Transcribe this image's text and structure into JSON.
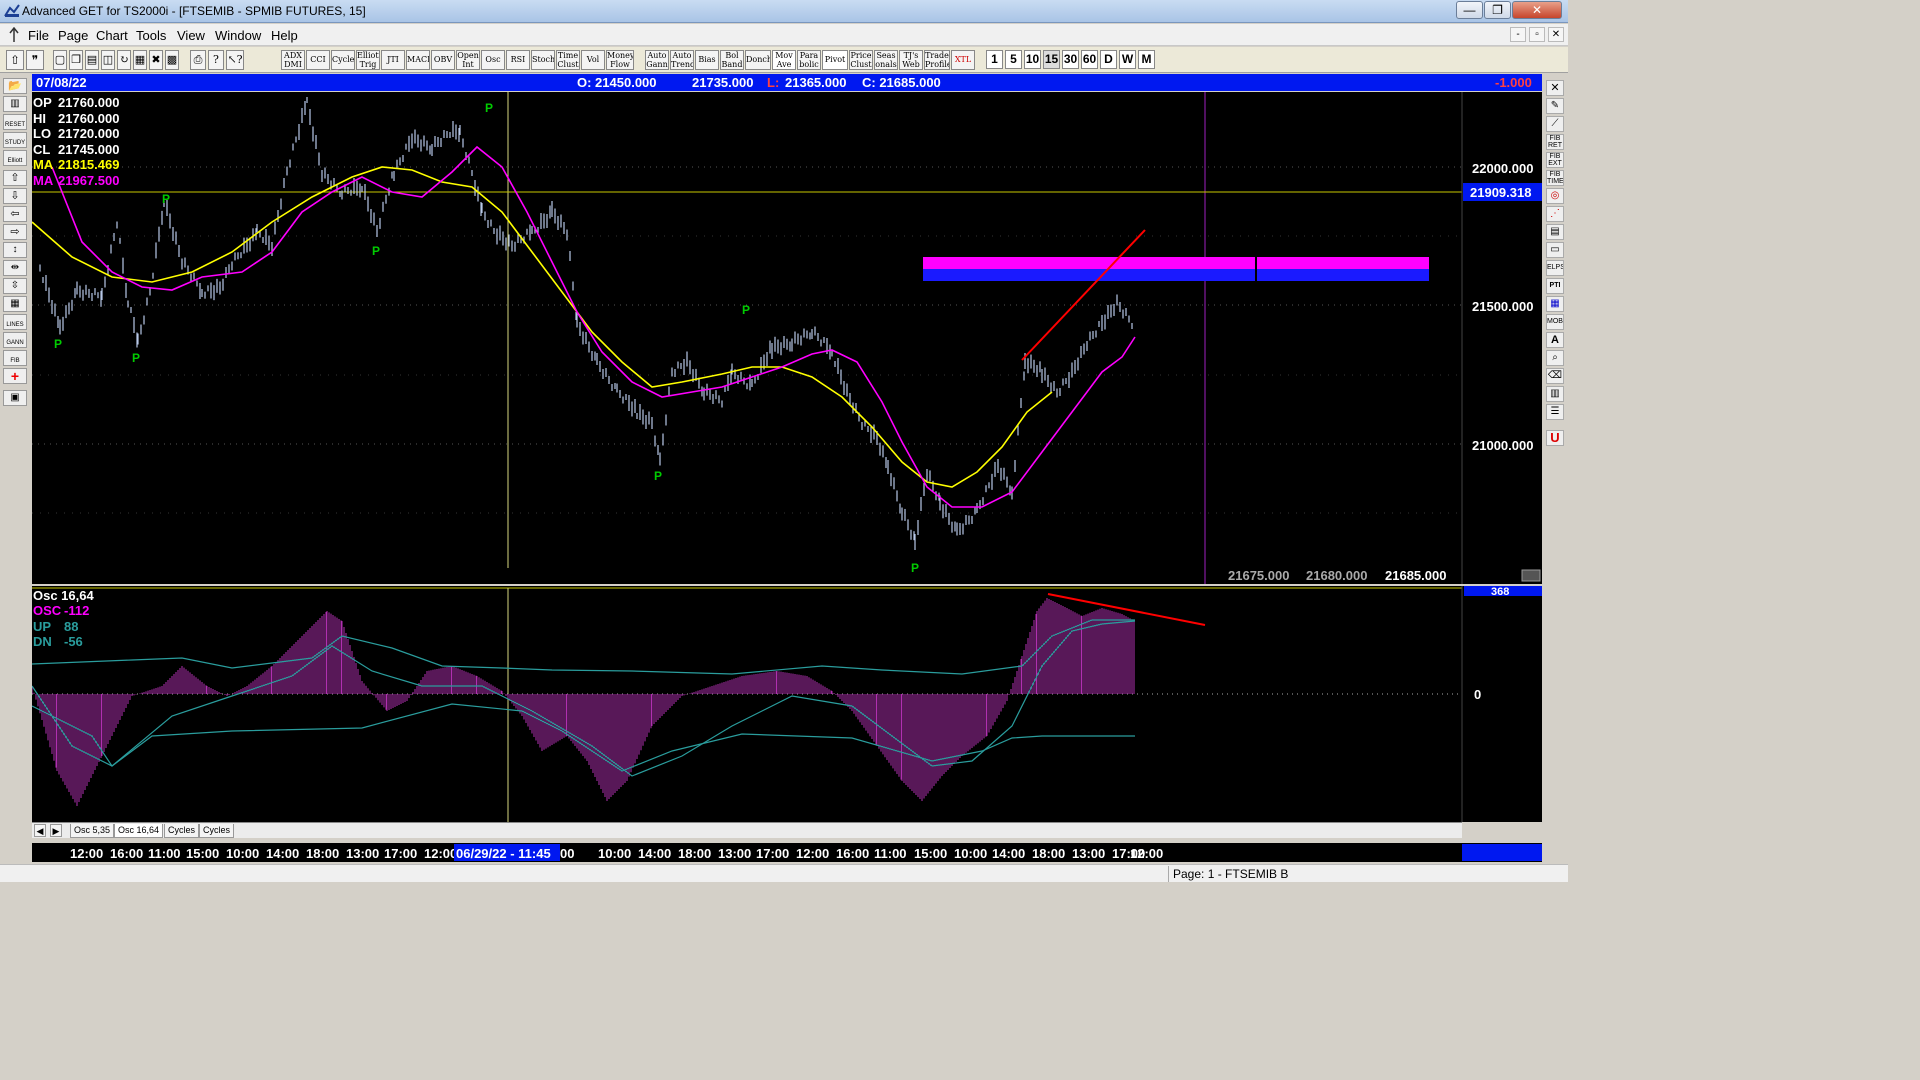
{
  "window": {
    "title": "Advanced GET for TS2000i - [FTSEMIB - SPMIB FUTURES, 15]",
    "buttons": {
      "minimize": "—",
      "restore": "❐",
      "close": "✕"
    }
  },
  "menu": {
    "items": [
      "File",
      "Page",
      "Chart",
      "Tools",
      "View",
      "Window",
      "Help"
    ],
    "mdi_buttons": [
      "-",
      "▫",
      "✕"
    ]
  },
  "toolbar": {
    "indicators": [
      "ADX DMI",
      "CCI",
      "Cycles",
      "Elliott Trig",
      "JTI",
      "MACD",
      "OBV",
      "Open Int",
      "Osc",
      "RSI",
      "Stoch",
      "Time Clust",
      "Vol",
      "Money Flow",
      "Auto Gann",
      "Auto Trend",
      "Bias",
      "Bol Band",
      "Donch",
      "Mov Ave",
      "Para bolic",
      "Pivot",
      "Price Clust",
      "Seas onals",
      "TJ's Web",
      "Trade Profile",
      "XTL"
    ],
    "timeframes": [
      "1",
      "5",
      "10",
      "15",
      "30",
      "60",
      "D",
      "W",
      "M"
    ]
  },
  "left_tools": [
    "",
    "",
    "RESET",
    "STUDY",
    "Elliott",
    "",
    "",
    "",
    "",
    "",
    "",
    "",
    "LINES",
    "GANN",
    "FIB",
    "+",
    ""
  ],
  "right_tools": [
    "✕",
    "",
    "",
    "FIB RET",
    "FIB EXT",
    "FIB TIME",
    "",
    "",
    "",
    "",
    "ELPS",
    "PTI",
    "",
    "MOB",
    "A",
    "",
    "",
    "",
    "",
    "U"
  ],
  "info_bar": {
    "date": "07/08/22",
    "open": "O: 21450.000",
    "high": "21735.000",
    "low_label": "L:",
    "low": "21365.000",
    "close": "C: 21685.000",
    "change": "-1.000"
  },
  "price_panel": {
    "readout": [
      {
        "label": "OP",
        "value": "21760.000",
        "color": "#ffffff"
      },
      {
        "label": "HI",
        "value": "21760.000",
        "color": "#ffffff"
      },
      {
        "label": "LO",
        "value": "21720.000",
        "color": "#ffffff"
      },
      {
        "label": "CL",
        "value": "21745.000",
        "color": "#ffffff"
      },
      {
        "label": "MA",
        "value": "21815.469",
        "color": "#ffff00"
      },
      {
        "label": "MA",
        "value": "21967.500",
        "color": "#ff00ff"
      }
    ],
    "axis_labels": [
      "22000.000",
      "21500.000",
      "21000.000"
    ],
    "current_price_label": "21909.318",
    "bottom_readouts": [
      "21675.000",
      "21680.000",
      "21685.000"
    ],
    "pivot_marker": "P"
  },
  "osc_panel": {
    "title": "Osc 16,64",
    "readout": [
      {
        "label": "OSC",
        "value": "-112",
        "color": "#ff00ff"
      },
      {
        "label": "UP",
        "value": "88",
        "color": "#2a9d9d"
      },
      {
        "label": "DN",
        "value": "-56",
        "color": "#2a9d9d"
      }
    ],
    "axis_top": "368",
    "axis_zero": "0"
  },
  "tabs": [
    "Osc 5,35",
    "Osc 16,64",
    "Cycles",
    "Cycles"
  ],
  "time_axis": {
    "labels": [
      "12:00",
      "16:00",
      "11:00",
      "15:00",
      "10:00",
      "14:00",
      "18:00",
      "13:00",
      "17:00",
      "12:00",
      "06/29/22 - 11:45",
      "00",
      "10:00",
      "14:00",
      "18:00",
      "13:00",
      "17:00",
      "12:00",
      "16:00",
      "11:00",
      "15:00",
      "10:00",
      "14:00",
      "18:00",
      "13:00",
      "17:00",
      "12:00"
    ],
    "highlight": "06/29/22 - 11:45"
  },
  "status": {
    "page": "Page: 1 - FTSEMIB B"
  },
  "colors": {
    "background": "#000000",
    "info_bar": "#0018f0",
    "ma_fast": "#ffff00",
    "ma_slow": "#ff00ff",
    "trendline": "#ff0000",
    "pivot": "#00cc00",
    "oscillator": "#cc33cc",
    "bands": "#2a9d9d"
  }
}
